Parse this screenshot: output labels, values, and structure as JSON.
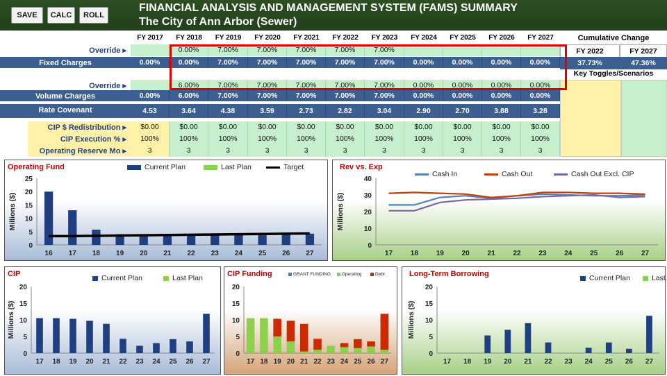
{
  "toolbar": {
    "save": "SAVE",
    "calc": "CALC",
    "roll": "ROLL"
  },
  "header": {
    "title": "FINANCIAL ANALYSIS AND MANAGEMENT SYSTEM (FAMS) SUMMARY",
    "subtitle": "The City of Ann Arbor (Sewer)"
  },
  "years": [
    "FY 2017",
    "FY 2018",
    "FY 2019",
    "FY 2020",
    "FY 2021",
    "FY 2022",
    "FY 2023",
    "FY 2024",
    "FY 2025",
    "FY 2026",
    "FY 2027"
  ],
  "rows": [
    {
      "label": "Override ▸",
      "values": [
        "",
        "0.00%",
        "7.00%",
        "7.00%",
        "7.00%",
        "7.00%",
        "7.00%",
        "",
        "",
        "",
        ""
      ]
    },
    {
      "label": "Fixed Charges",
      "values": [
        "0.00%",
        "0.00%",
        "7.00%",
        "7.00%",
        "7.00%",
        "7.00%",
        "7.00%",
        "0.00%",
        "0.00%",
        "0.00%",
        "0.00%"
      ]
    },
    {
      "label": "Override ▸",
      "values": [
        "",
        "6.00%",
        "7.00%",
        "7.00%",
        "7.00%",
        "7.00%",
        "7.00%",
        "0.00%",
        "0.00%",
        "0.00%",
        "0.00%"
      ]
    },
    {
      "label": "Volume Charges",
      "values": [
        "0.00%",
        "6.00%",
        "7.00%",
        "7.00%",
        "7.00%",
        "7.00%",
        "7.00%",
        "0.00%",
        "0.00%",
        "0.00%",
        "0.00%"
      ]
    },
    {
      "label": "Rate Covenant",
      "values": [
        "4.53",
        "3.64",
        "4.38",
        "3.59",
        "2.73",
        "2.82",
        "3.04",
        "2.90",
        "2.70",
        "3.88",
        "3.28"
      ]
    },
    {
      "label": "CIP $ Redistribution ▸",
      "values": [
        "$0.00",
        "$0.00",
        "$0.00",
        "$0.00",
        "$0.00",
        "$0.00",
        "$0.00",
        "$0.00",
        "$0.00",
        "$0.00",
        "$0.00"
      ]
    },
    {
      "label": "CIP Execution % ▸",
      "values": [
        "100%",
        "100%",
        "100%",
        "100%",
        "100%",
        "100%",
        "100%",
        "100%",
        "100%",
        "100%",
        "100%"
      ]
    },
    {
      "label": "Operating Reserve Mo ▸",
      "values": [
        "3",
        "3",
        "3",
        "3",
        "3",
        "3",
        "3",
        "3",
        "3",
        "3",
        "3"
      ]
    }
  ],
  "cumulative": {
    "header": "Cumulative Change",
    "cols": [
      "FY 2022",
      "FY 2027"
    ],
    "values": [
      "37.73%",
      "47.36%"
    ],
    "toggles": "Key Toggles/Scenarios"
  },
  "colors": {
    "header_bg": "#2a4a20",
    "row_blue": "#3b5f91",
    "input_green": "#c6efce",
    "yellow_cell": "#fff2a8",
    "highlight_red": "#e00000"
  },
  "charts": {
    "operating_fund": {
      "title": "Operating Fund",
      "legend": [
        "Current Plan",
        "Last Plan",
        "Target"
      ],
      "ylabel": "Millions ($)"
    },
    "rev_exp": {
      "title": "Rev vs. Exp",
      "legend": [
        "Cash In",
        "Cash Out",
        "Cash Out Excl. CIP"
      ],
      "ylabel": "Millions ($)"
    },
    "cip": {
      "title": "CIP",
      "legend": [
        "Current Plan",
        "Last Plan"
      ],
      "ylabel": "Millions ($)"
    },
    "cip_funding": {
      "title": "CIP Funding",
      "legend": [
        "GRANT FUNDING",
        "Operating",
        "Debt"
      ]
    },
    "borrowing": {
      "title": "Long-Term Borrowing",
      "legend": [
        "Current Plan",
        "Last Plan"
      ],
      "ylabel": "Millions ($)"
    }
  },
  "chart_data": [
    {
      "type": "bar",
      "title": "Operating Fund",
      "categories": [
        "16",
        "17",
        "18",
        "19",
        "20",
        "21",
        "22",
        "23",
        "24",
        "25",
        "26",
        "27"
      ],
      "ylim": [
        0,
        25
      ],
      "ylabel": "Millions ($)",
      "series": [
        {
          "name": "Current Plan",
          "values": [
            20,
            13,
            5.7,
            4,
            4,
            4,
            4,
            4,
            4,
            4,
            4,
            4.2
          ]
        },
        {
          "name": "Target",
          "type": "line",
          "values": [
            3.3,
            3.3,
            3.4,
            3.5,
            3.6,
            3.7,
            3.8,
            3.9,
            4.0,
            4.1,
            4.2,
            4.3
          ]
        }
      ]
    },
    {
      "type": "line",
      "title": "Rev vs. Exp",
      "categories": [
        "17",
        "18",
        "19",
        "20",
        "21",
        "22",
        "23",
        "24",
        "25",
        "26",
        "27"
      ],
      "ylim": [
        0,
        40
      ],
      "ylabel": "Millions ($)",
      "series": [
        {
          "name": "Cash In",
          "values": [
            24,
            24,
            28.5,
            29.5,
            28,
            29.5,
            30.5,
            30,
            29.5,
            29.5,
            30
          ]
        },
        {
          "name": "Cash Out",
          "values": [
            31,
            31.5,
            31,
            30.5,
            28.5,
            29.5,
            31.5,
            31.5,
            31,
            31,
            30.5
          ]
        },
        {
          "name": "Cash Out Excl. CIP",
          "values": [
            20.5,
            20.5,
            25.5,
            27,
            27.5,
            28,
            29,
            29.5,
            30,
            28.5,
            29
          ]
        }
      ]
    },
    {
      "type": "bar",
      "title": "CIP",
      "categories": [
        "17",
        "18",
        "19",
        "20",
        "21",
        "22",
        "23",
        "24",
        "25",
        "26",
        "27"
      ],
      "ylim": [
        0,
        20
      ],
      "ylabel": "Millions ($)",
      "series": [
        {
          "name": "Current Plan",
          "values": [
            10.5,
            10.5,
            10.3,
            9.7,
            8.8,
            4.3,
            2.2,
            3,
            4.2,
            3.5,
            11.8
          ]
        }
      ]
    },
    {
      "type": "bar",
      "title": "CIP Funding",
      "categories": [
        "17",
        "18",
        "19",
        "20",
        "21",
        "22",
        "23",
        "24",
        "25",
        "26",
        "27"
      ],
      "ylim": [
        0,
        20
      ],
      "series": [
        {
          "name": "GRANT FUNDING",
          "values": [
            0,
            0,
            0,
            0,
            0,
            0,
            0,
            0,
            0,
            0,
            0
          ]
        },
        {
          "name": "Operating",
          "values": [
            10.5,
            10.5,
            5,
            3.5,
            0.5,
            1,
            2.2,
            1.8,
            1.5,
            2,
            1
          ]
        },
        {
          "name": "Debt",
          "values": [
            0,
            0,
            5.3,
            6.2,
            8.3,
            3.3,
            0,
            1.2,
            2.7,
            1.5,
            10.8
          ]
        }
      ]
    },
    {
      "type": "bar",
      "title": "Long-Term Borrowing",
      "categories": [
        "17",
        "18",
        "19",
        "20",
        "21",
        "22",
        "23",
        "24",
        "25",
        "26",
        "27"
      ],
      "ylim": [
        0,
        20
      ],
      "ylabel": "Millions ($)",
      "series": [
        {
          "name": "Current Plan",
          "values": [
            0,
            0,
            5.3,
            7,
            9,
            3.2,
            0,
            1.6,
            3.2,
            1.3,
            11.2
          ]
        }
      ]
    }
  ]
}
